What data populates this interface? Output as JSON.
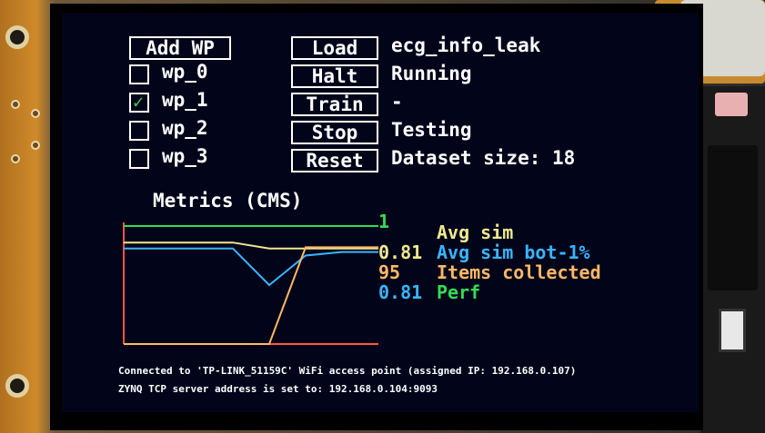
{
  "controls": {
    "add_wp": "Add WP",
    "load": "Load",
    "halt": "Halt",
    "train": "Train",
    "stop": "Stop",
    "reset": "Reset"
  },
  "waypoints": [
    {
      "label": "wp_0",
      "checked": false
    },
    {
      "label": "wp_1",
      "checked": true
    },
    {
      "label": "wp_2",
      "checked": false
    },
    {
      "label": "wp_3",
      "checked": false
    }
  ],
  "status_values": {
    "load": "ecg_info_leak",
    "halt": "Running",
    "train": "-",
    "stop": "Testing",
    "reset": "Dataset size: 18"
  },
  "metrics": {
    "title": "Metrics (CMS)",
    "values": [
      "1",
      "0.81",
      "95",
      "0.81"
    ],
    "labels": [
      "Avg sim",
      "Avg sim bot-1%",
      "Items collected",
      "Perf"
    ]
  },
  "colors": {
    "green": "#33dd55",
    "yellow": "#f0e890",
    "orange": "#ffb866",
    "blue": "#3ab4ff",
    "red": "#ff5540"
  },
  "chart_data": {
    "type": "line",
    "title": "Metrics (CMS)",
    "ylim": [
      0,
      1
    ],
    "grid": false,
    "series": [
      {
        "name": "Perf",
        "values": [
          1,
          1,
          1,
          1,
          1,
          1,
          1,
          1
        ]
      },
      {
        "name": "Avg sim",
        "values": [
          0.86,
          0.86,
          0.86,
          0.86,
          0.81,
          0.81,
          0.81,
          0.81
        ]
      },
      {
        "name": "Avg sim bot-1%",
        "values": [
          0.81,
          0.81,
          0.81,
          0.81,
          0.5,
          0.75,
          0.78,
          0.78
        ]
      },
      {
        "name": "Items collected",
        "values": [
          0,
          0,
          0,
          0,
          0,
          0.82,
          0.82,
          0.82
        ]
      }
    ]
  },
  "footer": {
    "line1": "Connected to 'TP-LINK_51159C' WiFi access point (assigned IP: 192.168.0.107)",
    "line2": "ZYNQ TCP server address is set to: 192.168.0.104:9093"
  }
}
